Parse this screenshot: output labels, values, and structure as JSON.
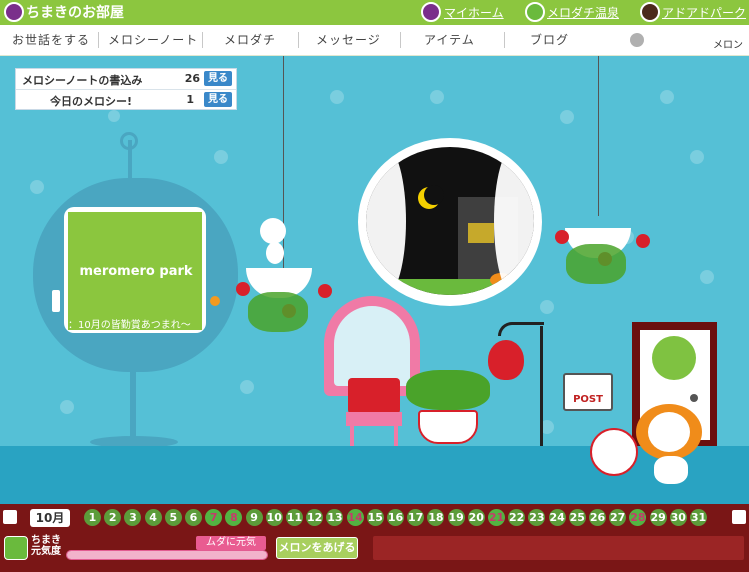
{
  "header": {
    "room_title": "ちまきのお部屋",
    "links": [
      {
        "label": "マイホーム",
        "icon": "purple-character-icon"
      },
      {
        "label": "メロダチ温泉",
        "icon": "green-character-icon"
      },
      {
        "label": "アドアドパーク",
        "icon": "red-character-icon"
      }
    ]
  },
  "nav": {
    "items": [
      "お世話をする",
      "メロシーノート",
      "メロダチ",
      "メッセージ",
      "アイテム",
      "ブログ"
    ],
    "melon_label": "メロン"
  },
  "notifications": [
    {
      "label": "メロシーノートの書込み",
      "count": "26",
      "button": "見る"
    },
    {
      "label": "今日のメロシー!",
      "count": "1",
      "button": "見る"
    }
  ],
  "tv": {
    "logo": "meromero park",
    "ticker": "：10月の皆勤賞あつまれ〜"
  },
  "post_sign": "POST",
  "calendar": {
    "month": "10月",
    "days": [
      "1",
      "2",
      "3",
      "4",
      "5",
      "6",
      "7",
      "8",
      "9",
      "10",
      "11",
      "12",
      "13",
      "14",
      "15",
      "16",
      "17",
      "18",
      "19",
      "20",
      "21",
      "22",
      "23",
      "24",
      "25",
      "26",
      "27",
      "28",
      "29",
      "30",
      "31"
    ]
  },
  "status": {
    "pet_name_line1": "ちまき",
    "pet_name_line2": "元気度",
    "energy_label": "ムダに元気",
    "energy_level": 1.0,
    "give_melon_button": "メロンをあげる"
  },
  "colors": {
    "header_green": "#8cc63f",
    "wall_blue": "#55c0d6",
    "bottom_maroon": "#7a1616"
  }
}
